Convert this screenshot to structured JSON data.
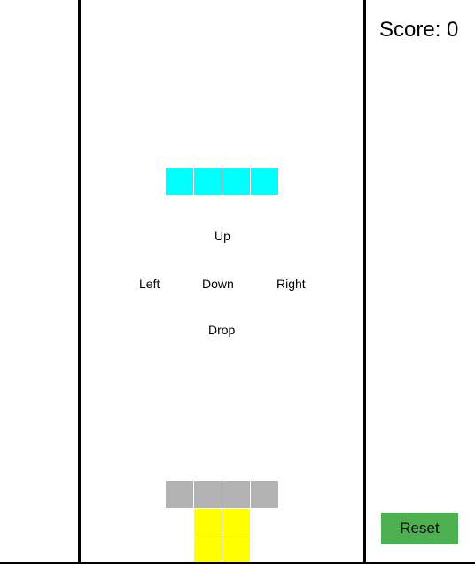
{
  "score": {
    "text": "Score: 0"
  },
  "controls": {
    "up": "Up",
    "left": "Left",
    "down": "Down",
    "right": "Right",
    "drop": "Drop"
  },
  "reset": {
    "label": "Reset"
  },
  "colors": {
    "i_piece": "#00ffff",
    "ghost": "#b3b3b3",
    "o_piece": "#ffff00",
    "reset_button": "#4caf50"
  }
}
